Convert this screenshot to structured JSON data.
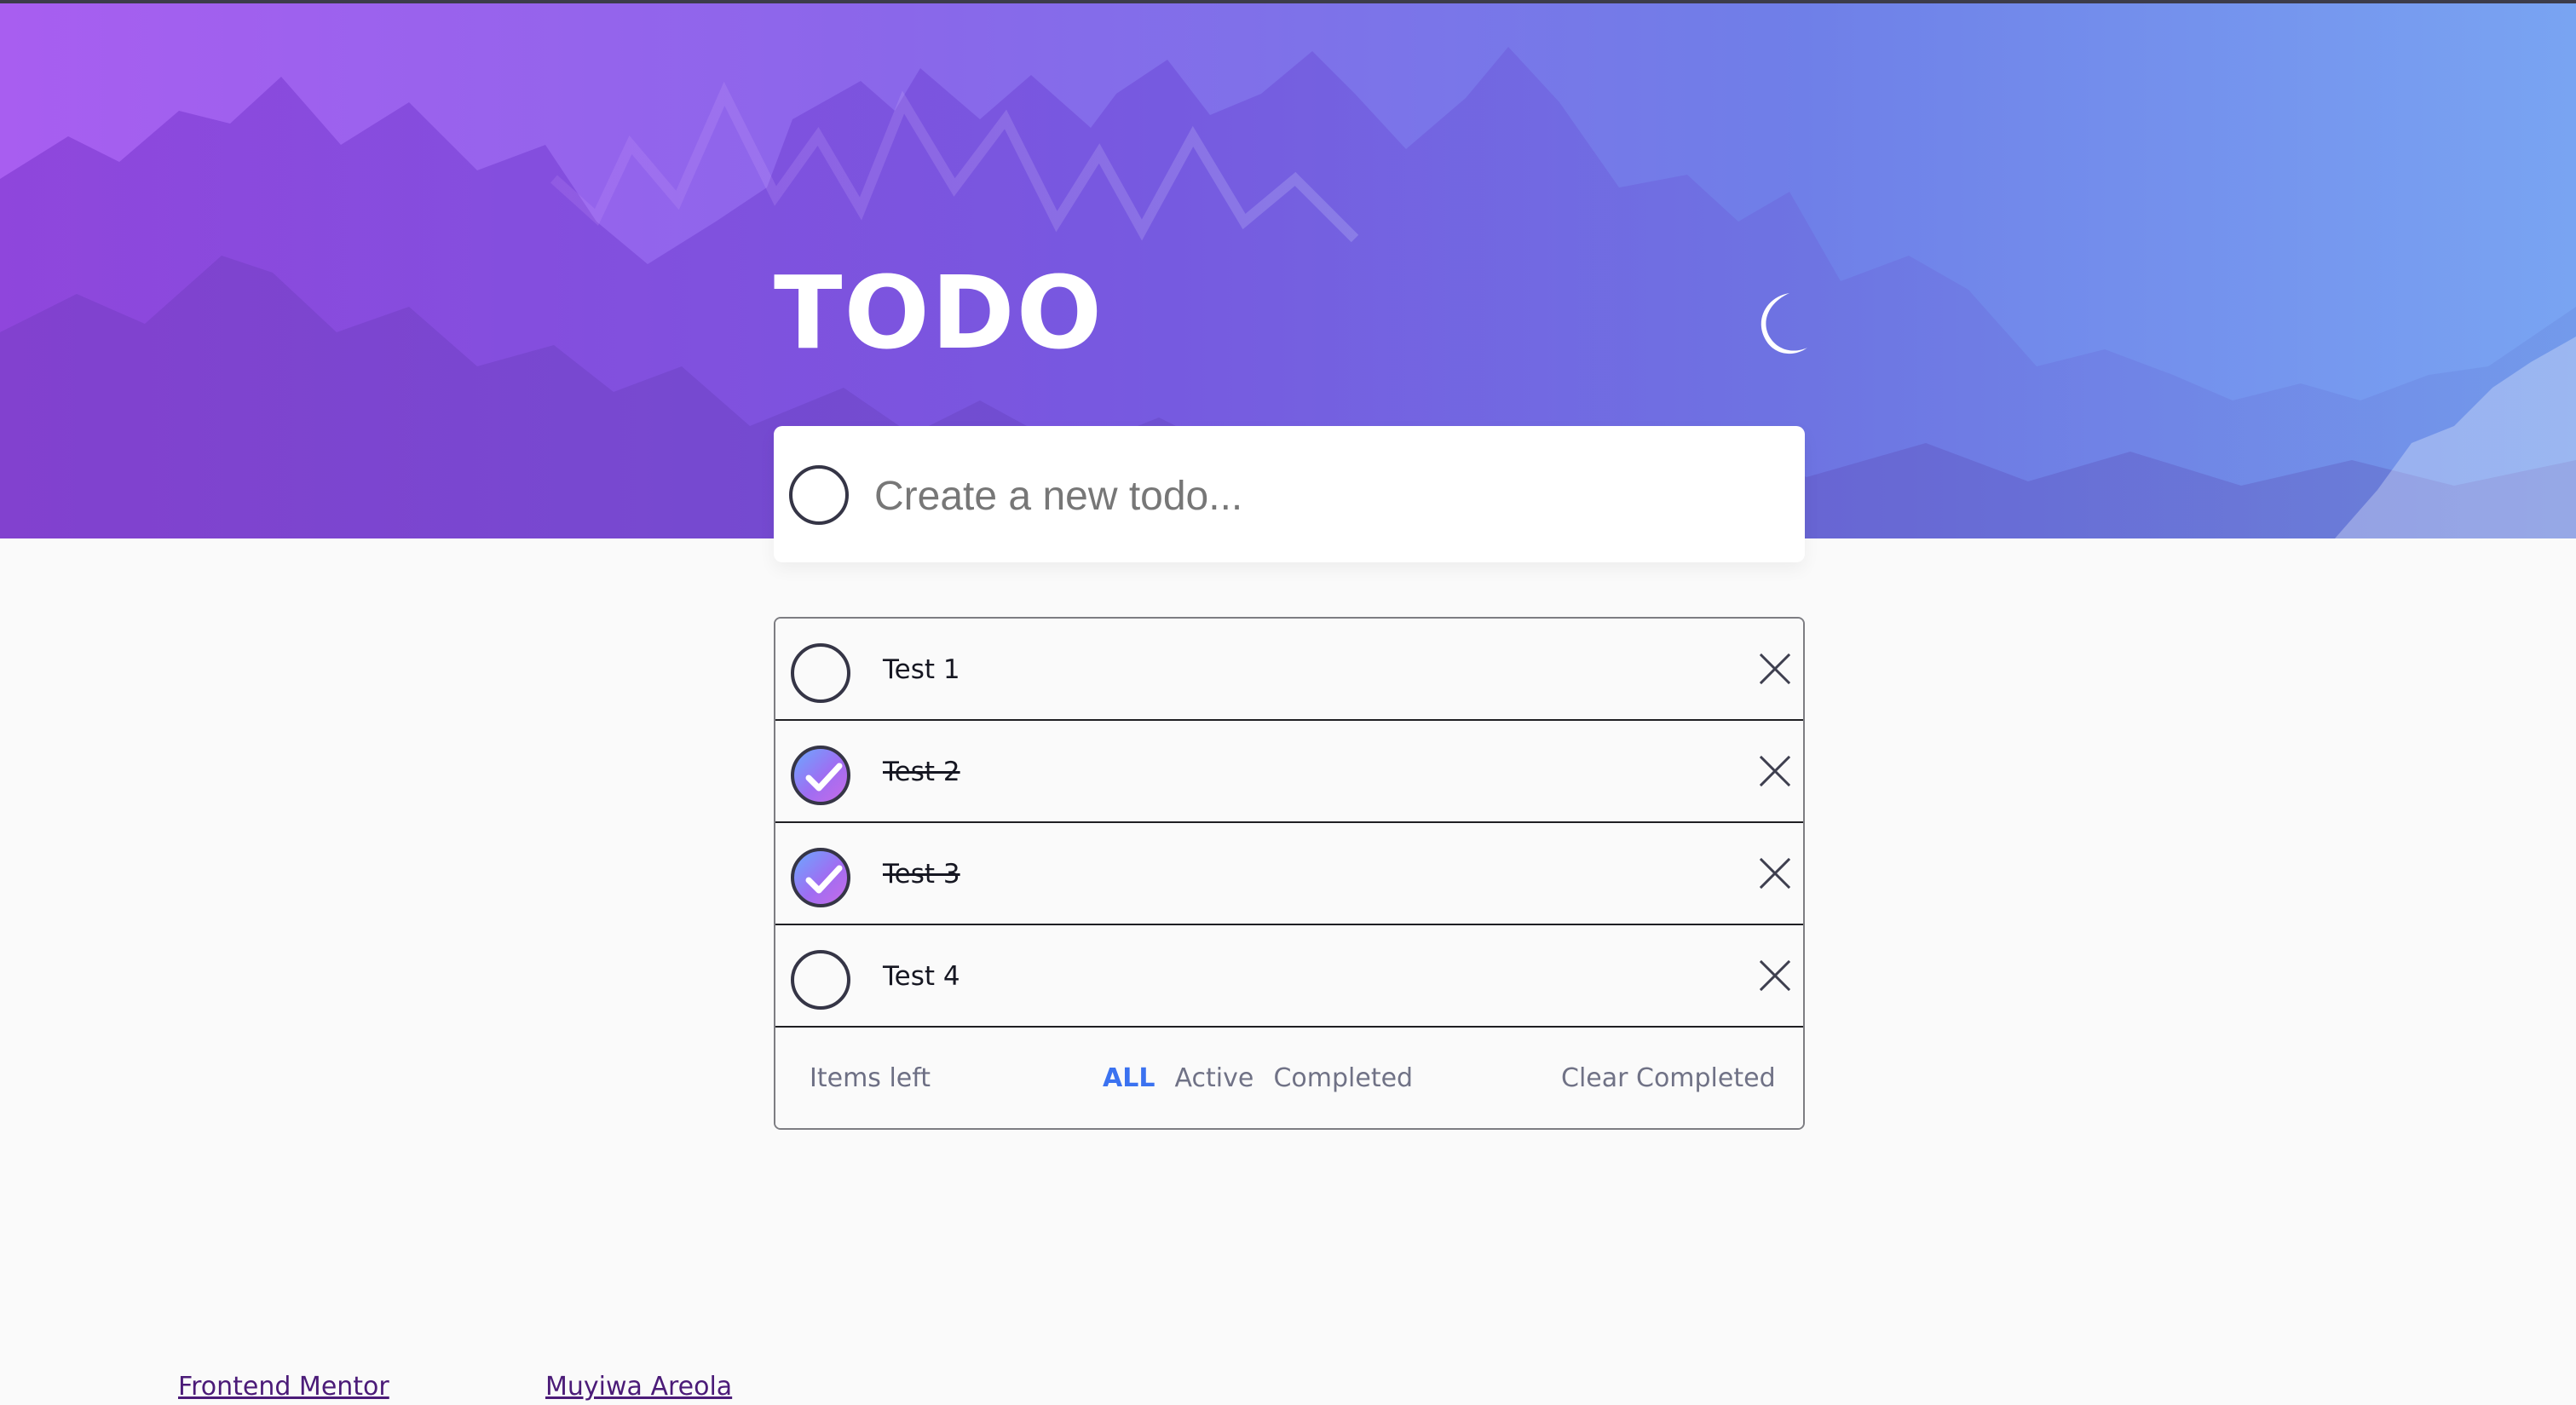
{
  "header": {
    "title": "TODO",
    "theme_icon": "moon-icon"
  },
  "new_todo": {
    "placeholder": "Create a new todo...",
    "value": ""
  },
  "todos": [
    {
      "text": "Test 1",
      "completed": false
    },
    {
      "text": "Test 2",
      "completed": true
    },
    {
      "text": "Test 3",
      "completed": true
    },
    {
      "text": "Test 4",
      "completed": false
    }
  ],
  "footer": {
    "items_left_label": "Items left",
    "filters": {
      "all": "ALL",
      "active": "Active",
      "completed": "Completed"
    },
    "active_filter": "all",
    "clear_label": "Clear Completed"
  },
  "credits": {
    "frontend_mentor": "Frontend Mentor",
    "author": "Muyiwa Areola"
  },
  "colors": {
    "accent_blue": "#3b72f0",
    "check_gradient_start": "#6ba8ff",
    "check_gradient_end": "#c66ce8",
    "hero_left": "#a85ef0",
    "hero_right": "#79a4f2"
  }
}
